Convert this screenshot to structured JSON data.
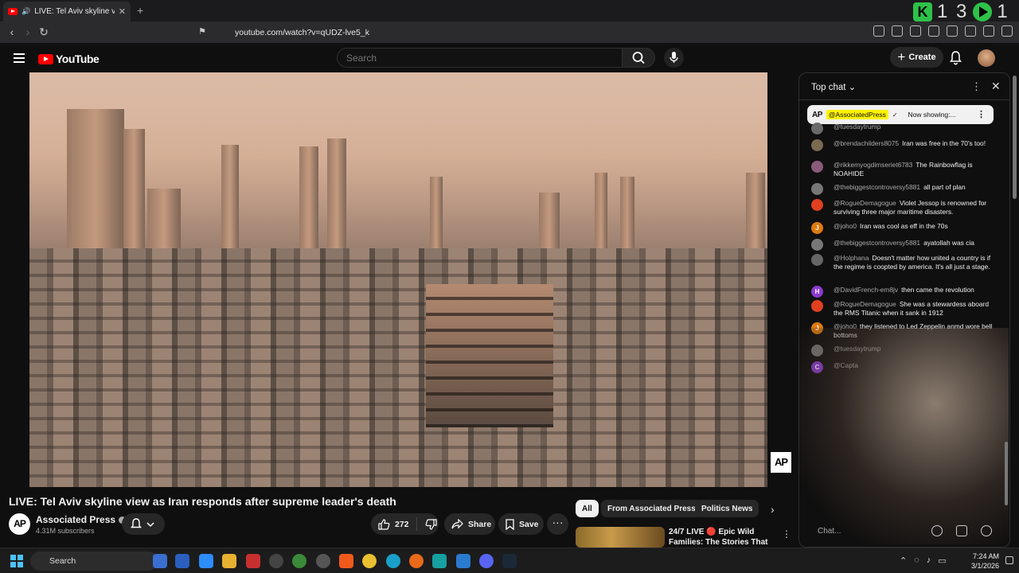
{
  "browser": {
    "tab_title": "LIVE: Tel Aviv skyline view as I",
    "url": "youtube.com/watch?v=qUDZ-lve5_k",
    "extension_counter": "1 3",
    "extension_counter_2": "1"
  },
  "youtube": {
    "logo_text": "YouTube",
    "search_placeholder": "Search",
    "create_label": "Create"
  },
  "video": {
    "title": "LIVE: Tel Aviv skyline view as Iran responds after supreme leader's death",
    "watermark": "AP",
    "channel": {
      "avatar_text": "AP",
      "name": "Associated Press",
      "subscribers": "4.31M subscribers"
    },
    "actions": {
      "likes": "272",
      "share": "Share",
      "save": "Save"
    }
  },
  "chips": [
    "All",
    "From Associated Press",
    "Politics News"
  ],
  "recommended": {
    "title": "24/7 LIVE 🔴 Epic Wild Families: The Stories That ..."
  },
  "chat": {
    "header": "Top chat",
    "pinned": {
      "avatar_text": "AP",
      "author": "@AssociatedPress",
      "text": "Now showing:..."
    },
    "messages": [
      {
        "author": "@tuesdaytrump",
        "text": "",
        "avatar": "",
        "color": "#6a6a6a"
      },
      {
        "author": "@brendachilders8075",
        "text": "Iran was free in the 70's too!",
        "avatar": "",
        "color": "#7a6a50"
      },
      {
        "author": "@rikkemyogdimseriet6783",
        "text": "The Rainbowflag is NOAHIDE",
        "avatar": "",
        "color": "#8a5a7a"
      },
      {
        "author": "@thebiggestcontroversy5881",
        "text": "all part of plan",
        "avatar": "",
        "color": "#777"
      },
      {
        "author": "@RogueDemagogue",
        "text": "Violet Jessop is renowned for surviving three major maritime disasters.",
        "avatar": "",
        "color": "#e04020"
      },
      {
        "author": "@joho0",
        "text": "Iran was cool as eff in the 70s",
        "avatar": "J",
        "color": "#e07a10"
      },
      {
        "author": "@thebiggestcontroversy5881",
        "text": "ayatollah was cia",
        "avatar": "",
        "color": "#777"
      },
      {
        "author": "@Holphana",
        "text": "Doesn't matter how united a country is if the regime is coopted by america. It's all just a stage.",
        "avatar": "",
        "color": "#666"
      },
      {
        "author": "@DavidFrench-em8jv",
        "text": "then came the revolution",
        "avatar": "H",
        "color": "#8a3ad0"
      },
      {
        "author": "@RogueDemagogue",
        "text": "She was a stewardess aboard the RMS Titanic when it sank in 1912",
        "avatar": "",
        "color": "#e04020"
      },
      {
        "author": "@joho0",
        "text": "they listened to Led Zeppelin anmd wore bell bottoms",
        "avatar": "J",
        "color": "#e07a10"
      },
      {
        "author": "@tuesdaytrump",
        "text": "",
        "avatar": "",
        "color": "#777"
      },
      {
        "author": "@Capta",
        "text": "",
        "avatar": "C",
        "color": "#8a3ad0"
      }
    ],
    "input_placeholder": "Chat..."
  },
  "taskbar": {
    "search_label": "Search",
    "time": "7:24 AM",
    "date": "3/1/2026"
  }
}
